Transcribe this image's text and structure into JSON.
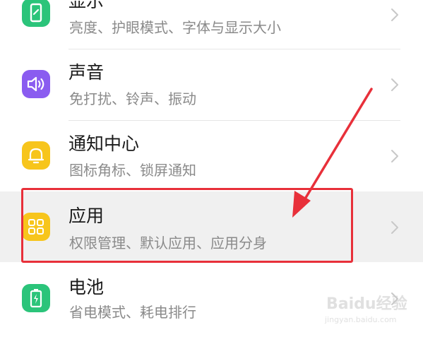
{
  "settings": {
    "items": [
      {
        "title": "显示",
        "subtitle": "亮度、护眼模式、字体与显示大小",
        "icon": "display-icon",
        "icon_color": "#2bc47a"
      },
      {
        "title": "声音",
        "subtitle": "免打扰、铃声、振动",
        "icon": "speaker-icon",
        "icon_color": "#8a5cf0"
      },
      {
        "title": "通知中心",
        "subtitle": "图标角标、锁屏通知",
        "icon": "bell-icon",
        "icon_color": "#f7c51c"
      },
      {
        "title": "应用",
        "subtitle": "权限管理、默认应用、应用分身",
        "icon": "apps-grid-icon",
        "icon_color": "#f7c51c",
        "highlighted": true
      },
      {
        "title": "电池",
        "subtitle": "省电模式、耗电排行",
        "icon": "battery-icon",
        "icon_color": "#2bc47a"
      }
    ]
  },
  "annotation": {
    "highlight_color": "#e8303a",
    "arrow_target": "应用"
  },
  "watermark": {
    "logo": "Baidu经验",
    "url": "jingyan.baidu.com"
  }
}
